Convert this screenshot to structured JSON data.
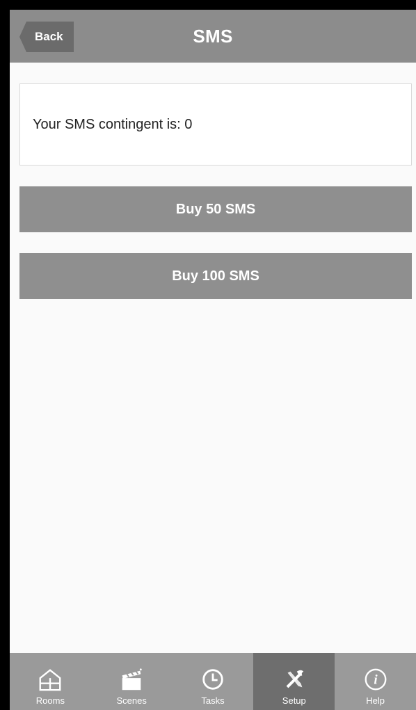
{
  "header": {
    "back_label": "Back",
    "title": "SMS"
  },
  "info": {
    "text": "Your SMS contingent is: 0"
  },
  "buttons": {
    "buy50": "Buy 50 SMS",
    "buy100": "Buy 100 SMS"
  },
  "tabbar": {
    "active": "Setup",
    "tabs": [
      {
        "label": "Rooms",
        "icon": "house-icon"
      },
      {
        "label": "Scenes",
        "icon": "clapperboard-icon"
      },
      {
        "label": "Tasks",
        "icon": "clock-icon"
      },
      {
        "label": "Setup",
        "icon": "tools-icon"
      },
      {
        "label": "Help",
        "icon": "info-icon"
      }
    ]
  }
}
